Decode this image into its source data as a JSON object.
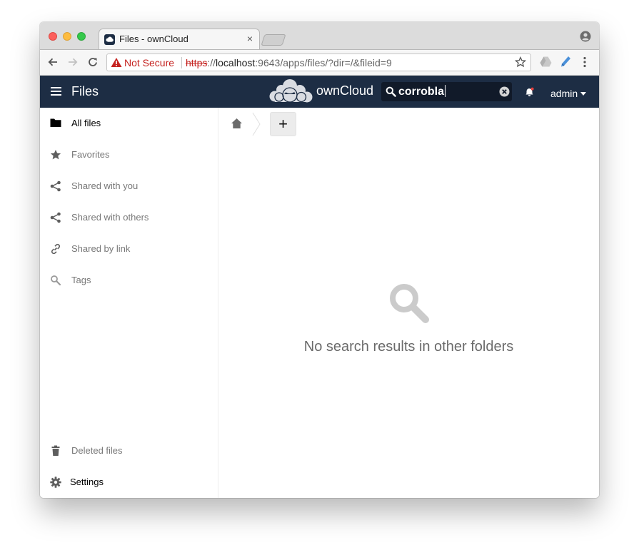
{
  "browser": {
    "tab_title": "Files - ownCloud",
    "tab_close": "×",
    "security_label": "Not Secure",
    "url_scheme": "https",
    "url_sep": "://",
    "url_host": "localhost",
    "url_rest": ":9643/apps/files/?dir=/&fileid=9"
  },
  "header": {
    "app_title": "Files",
    "brand_name": "ownCloud",
    "search_value": "corrobla",
    "user": "admin"
  },
  "sidebar": {
    "items": [
      {
        "label": "All files",
        "icon": "folder-icon"
      },
      {
        "label": "Favorites",
        "icon": "star-icon"
      },
      {
        "label": "Shared with you",
        "icon": "share-icon"
      },
      {
        "label": "Shared with others",
        "icon": "share-icon"
      },
      {
        "label": "Shared by link",
        "icon": "link-icon"
      },
      {
        "label": "Tags",
        "icon": "tag-search-icon"
      }
    ],
    "deleted_label": "Deleted files",
    "settings_label": "Settings"
  },
  "content": {
    "add_label": "+",
    "empty_message": "No search results in other folders"
  },
  "colors": {
    "header_bg": "#1d2d44",
    "not_secure": "#c5221f"
  }
}
